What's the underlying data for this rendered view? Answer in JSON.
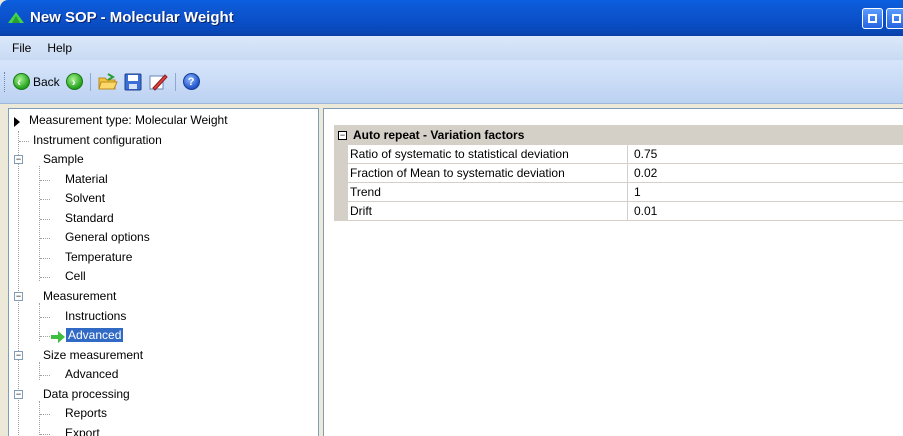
{
  "window": {
    "title": "New SOP - Molecular Weight"
  },
  "menu": {
    "items": [
      "File",
      "Help"
    ]
  },
  "toolbar": {
    "back_label": "Back"
  },
  "tree": {
    "root": "Measurement type: Molecular Weight",
    "items": [
      "Instrument configuration",
      "Sample",
      "Material",
      "Solvent",
      "Standard",
      "General options",
      "Temperature",
      "Cell",
      "Measurement",
      "Instructions",
      "Advanced",
      "Size measurement",
      "Advanced",
      "Data processing",
      "Reports",
      "Export"
    ],
    "selected": "Advanced"
  },
  "properties": {
    "section_title": "Auto repeat - Variation factors",
    "rows": [
      {
        "name": "Ratio of systematic to statistical deviation",
        "value": "0.75"
      },
      {
        "name": "Fraction of Mean to systematic deviation",
        "value": "0.02"
      },
      {
        "name": "Trend",
        "value": "1"
      },
      {
        "name": "Drift",
        "value": "0.01"
      }
    ]
  },
  "icons": {
    "app": "mountain-icon",
    "back": "back-arrow-icon",
    "forward": "forward-arrow-icon",
    "open": "open-folder-icon",
    "save": "save-disk-icon",
    "edit": "edit-pencil-icon",
    "help": "help-icon"
  },
  "colors": {
    "titlebar": "#0a4fc8",
    "selection": "#316ac5",
    "menubar": "#c8daf3"
  }
}
